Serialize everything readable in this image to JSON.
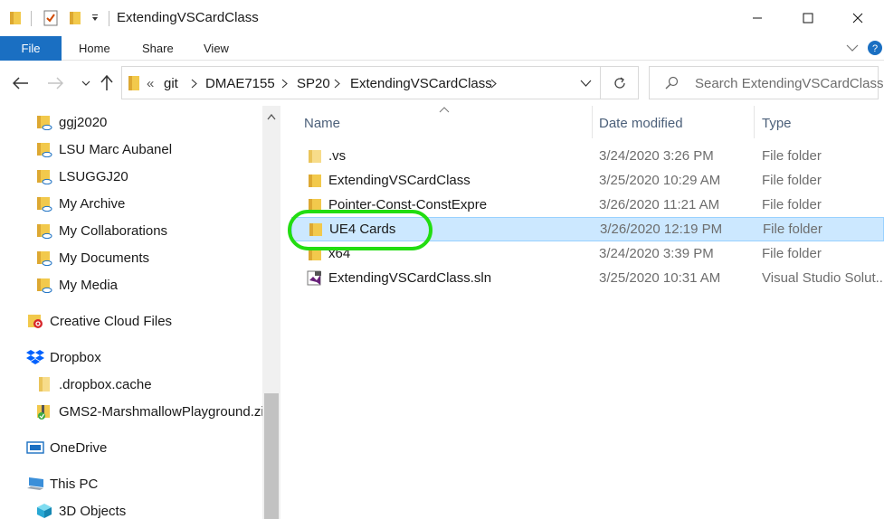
{
  "window": {
    "title": "ExtendingVSCardClass"
  },
  "ribbon": {
    "file_label": "File",
    "tabs": [
      "Home",
      "Share",
      "View"
    ]
  },
  "address": {
    "overflow": "«",
    "crumbs": [
      "git",
      "DMAE7155",
      "SP20",
      "ExtendingVSCardClass"
    ]
  },
  "search": {
    "placeholder": "Search ExtendingVSCardClass"
  },
  "nav_pane": {
    "items": [
      {
        "label": "ggj2020",
        "icon": "onedrive-folder-icon"
      },
      {
        "label": "LSU Marc Aubanel",
        "icon": "onedrive-folder-icon"
      },
      {
        "label": "LSUGGJ20",
        "icon": "onedrive-folder-icon"
      },
      {
        "label": "My Archive",
        "icon": "onedrive-folder-icon"
      },
      {
        "label": "My Collaborations",
        "icon": "onedrive-folder-icon"
      },
      {
        "label": "My Documents",
        "icon": "onedrive-folder-icon"
      },
      {
        "label": "My Media",
        "icon": "onedrive-folder-icon"
      },
      {
        "label": "Creative Cloud Files",
        "icon": "creative-cloud-icon"
      },
      {
        "label": "Dropbox",
        "icon": "dropbox-icon"
      },
      {
        "label": ".dropbox.cache",
        "icon": "folder-icon"
      },
      {
        "label": "GMS2-MarshmallowPlayground.zi",
        "icon": "zip-folder-icon"
      },
      {
        "label": "OneDrive",
        "icon": "onedrive-icon"
      },
      {
        "label": "This PC",
        "icon": "computer-icon"
      },
      {
        "label": "3D Objects",
        "icon": "3d-objects-icon"
      }
    ]
  },
  "file_list": {
    "columns": {
      "name": "Name",
      "date": "Date modified",
      "type": "Type"
    },
    "rows": [
      {
        "name": ".vs",
        "date": "3/24/2020 3:26 PM",
        "type": "File folder",
        "icon": "folder-icon",
        "selected": false
      },
      {
        "name": "ExtendingVSCardClass",
        "date": "3/25/2020 10:29 AM",
        "type": "File folder",
        "icon": "folder-icon",
        "selected": false
      },
      {
        "name": "Pointer-Const-ConstExpre",
        "date": "3/26/2020 11:21 AM",
        "type": "File folder",
        "icon": "folder-icon",
        "selected": false
      },
      {
        "name": "UE4 Cards",
        "date": "3/26/2020 12:19 PM",
        "type": "File folder",
        "icon": "folder-icon",
        "selected": true
      },
      {
        "name": "x64",
        "date": "3/24/2020 3:39 PM",
        "type": "File folder",
        "icon": "folder-icon",
        "selected": false
      },
      {
        "name": "ExtendingVSCardClass.sln",
        "date": "3/25/2020 10:31 AM",
        "type": "Visual Studio Solut...",
        "icon": "vs-solution-icon",
        "selected": false
      }
    ]
  },
  "colors": {
    "file_tab": "#1a6fc2",
    "selection_bg": "#cce8ff",
    "selection_border": "#99d1ff",
    "annotation_ring": "#22dd11",
    "folder": "#f2c94c"
  }
}
